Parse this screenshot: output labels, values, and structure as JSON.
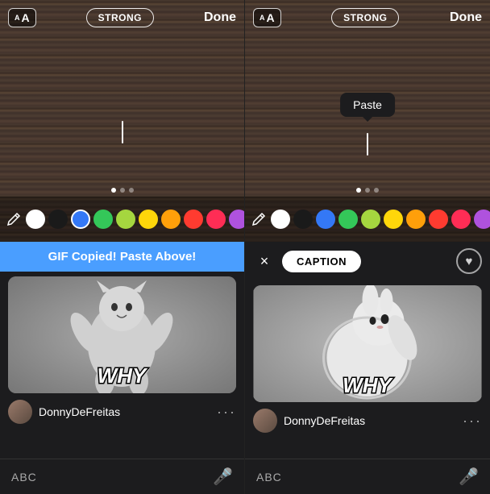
{
  "left_panel": {
    "editor": {
      "text_size_label": "A",
      "style_button": "STRONG",
      "done_button": "Done",
      "cursor_visible": true
    },
    "colors": [
      {
        "id": "pen",
        "type": "pen"
      },
      {
        "id": "white",
        "hex": "#ffffff",
        "selected": false
      },
      {
        "id": "black",
        "hex": "#1a1a1a",
        "selected": false
      },
      {
        "id": "blue",
        "hex": "#3478f6",
        "selected": true
      },
      {
        "id": "green",
        "hex": "#34c759",
        "selected": false
      },
      {
        "id": "yellow-green",
        "hex": "#a5d63f",
        "selected": false
      },
      {
        "id": "yellow",
        "hex": "#ffd60a",
        "selected": false
      },
      {
        "id": "orange",
        "hex": "#ff9f0a",
        "selected": false
      },
      {
        "id": "red",
        "hex": "#ff3b30",
        "selected": false
      },
      {
        "id": "pink",
        "hex": "#ff2d55",
        "selected": false
      },
      {
        "id": "purple",
        "hex": "#af52de",
        "selected": false
      },
      {
        "id": "light-purple",
        "hex": "#bf5af2",
        "selected": false
      }
    ],
    "dots": [
      3,
      "active",
      "inactive"
    ],
    "banner": {
      "text": "GIF Copied! Paste Above!"
    },
    "gif": {
      "why_text": "WHY",
      "username": "DonnyDeFreitas"
    },
    "keyboard": {
      "abc_label": "ABC",
      "mic_icon": "🎤"
    }
  },
  "right_panel": {
    "editor": {
      "text_size_label": "A",
      "style_button": "STRONG",
      "done_button": "Done",
      "paste_tooltip": "Paste",
      "cursor_visible": true
    },
    "colors": [
      {
        "id": "pen",
        "type": "pen"
      },
      {
        "id": "white",
        "hex": "#ffffff",
        "selected": false
      },
      {
        "id": "black",
        "hex": "#1a1a1a",
        "selected": false
      },
      {
        "id": "blue",
        "hex": "#3478f6",
        "selected": false
      },
      {
        "id": "green",
        "hex": "#34c759",
        "selected": false
      },
      {
        "id": "yellow-green",
        "hex": "#a5d63f",
        "selected": false
      },
      {
        "id": "yellow",
        "hex": "#ffd60a",
        "selected": false
      },
      {
        "id": "orange",
        "hex": "#ff9f0a",
        "selected": false
      },
      {
        "id": "red",
        "hex": "#ff3b30",
        "selected": false
      },
      {
        "id": "pink",
        "hex": "#ff2d55",
        "selected": false
      },
      {
        "id": "purple",
        "hex": "#af52de",
        "selected": false
      },
      {
        "id": "light-purple",
        "hex": "#bf5af2",
        "selected": false
      }
    ],
    "dots": [
      3,
      "active",
      "inactive"
    ],
    "caption_bar": {
      "close_icon": "×",
      "caption_label": "CAPTION",
      "heart_icon": "♥"
    },
    "gif": {
      "why_text": "WHY",
      "username": "DonnyDeFreitas"
    },
    "keyboard": {
      "abc_label": "ABC",
      "mic_icon": "🎤"
    }
  }
}
